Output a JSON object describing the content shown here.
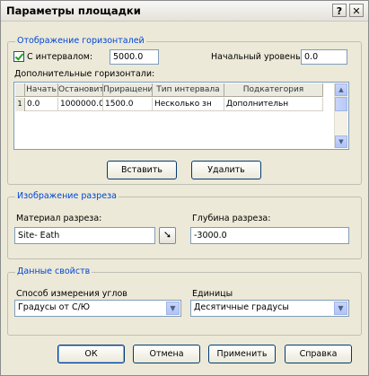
{
  "window": {
    "title": "Параметры площадки",
    "help_glyph": "?",
    "close_glyph": "✕"
  },
  "contours": {
    "legend": "Отображение горизонталей",
    "interval_checkbox_label": "С интервалом:",
    "interval_checked": true,
    "interval_value": "5000.0",
    "base_level_label": "Начальный уровень:",
    "base_level_value": "0.0",
    "additional_label": "Дополнительные горизонтали:",
    "table": {
      "columns": [
        "Начать",
        "Остановить",
        "Приращение",
        "Тип интервала",
        "Подкатегория"
      ],
      "rows": [
        {
          "num": "1",
          "cells": [
            "0.0",
            "1000000.0",
            "1500.0",
            "Несколько зн",
            "Дополнительн"
          ]
        }
      ]
    },
    "insert_button": "Вставить",
    "delete_button": "Удалить"
  },
  "section": {
    "legend": "Изображение разреза",
    "material_label": "Материал разреза:",
    "material_value": "Site- Eath",
    "depth_label": "Глубина разреза:",
    "depth_value": "-3000.0"
  },
  "properties": {
    "legend": "Данные свойств",
    "angle_label": "Способ измерения углов",
    "angle_value": "Градусы от С/Ю",
    "units_label": "Единицы",
    "units_value": "Десятичные градусы"
  },
  "buttons": {
    "ok": "ОК",
    "cancel": "Отмена",
    "apply": "Применить",
    "help": "Справка"
  }
}
